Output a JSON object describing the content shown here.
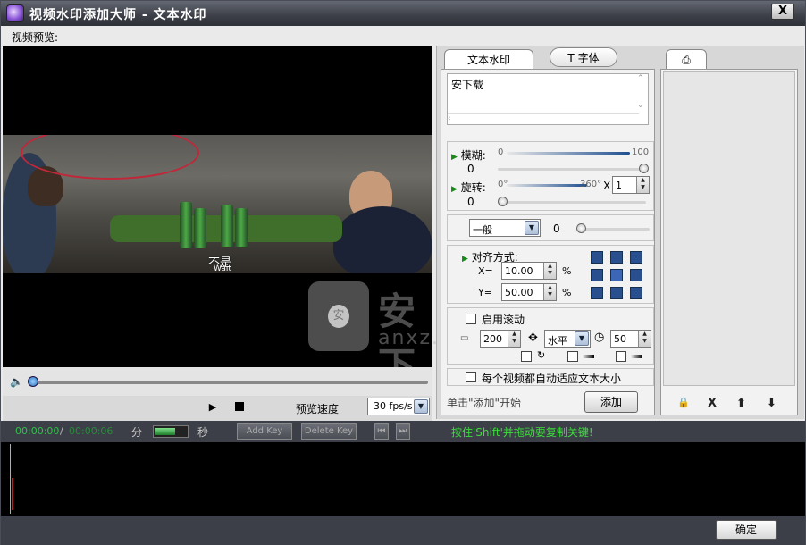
{
  "window": {
    "title": "视频水印添加大师 - 文本水印",
    "close_label": "X"
  },
  "preview": {
    "label": "视频预览:",
    "subtitle_cn": "不是",
    "subtitle_en": "Wait",
    "watermark_big": "安下载",
    "watermark_small": "anxz.com",
    "watermark_logo_char": "安",
    "play_label": "▶",
    "speed_label": "预览速度",
    "speed_value": "30 fps/s",
    "seek_progress": 0.0
  },
  "tabs": {
    "text_watermark": "文本水印",
    "font": "T 字体",
    "list_icon": "⎙"
  },
  "panel": {
    "text_value": "安下载",
    "blur": {
      "label": "模糊:",
      "min": "0",
      "max": "100",
      "value": "0"
    },
    "rotate": {
      "label": "旋转:",
      "min": "0°",
      "max": "360°",
      "x_label": "X",
      "multiplier": "1",
      "value": "0"
    },
    "mode": {
      "value": "一般",
      "level": "0"
    },
    "align": {
      "label": "对齐方式:",
      "x_label": "X=",
      "x_value": "10.00",
      "y_label": "Y=",
      "y_value": "50.00",
      "percent": "%"
    },
    "scroll": {
      "label": "启用滚动",
      "length": "200",
      "direction": "水平",
      "speed": "50"
    },
    "auto_fit_label": "每个视频都自动适应文本大小",
    "hint": "单击\"添加\"开始",
    "add_label": "添加"
  },
  "list_buttons": {
    "lock": "🔒",
    "delete": "X",
    "up": "⬆",
    "down": "⬇"
  },
  "timeline": {
    "current": "00:00:00",
    "separator": "/",
    "total": "00:00:06",
    "unit_min": "分",
    "unit_sec": "秒",
    "add_key": "Add Key",
    "delete_key": "Delete Key",
    "hint": "按住'Shift'并拖动要复制关键!"
  },
  "footer": {
    "ok_label": "确定"
  }
}
